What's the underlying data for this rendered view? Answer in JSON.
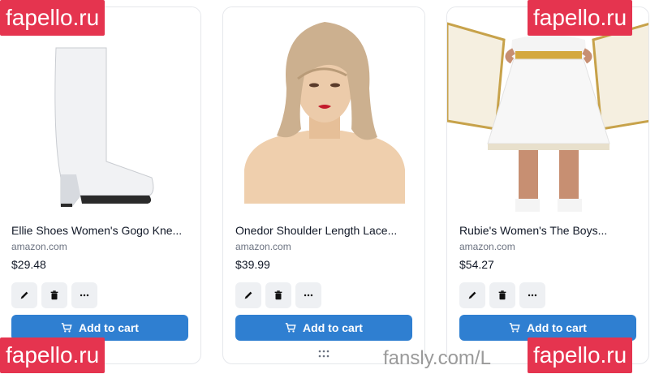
{
  "products": [
    {
      "title": "Ellie Shoes Women's Gogo Kne...",
      "source": "amazon.com",
      "price": "$29.48",
      "image": "white-knee-boot"
    },
    {
      "title": "Onedor Shoulder Length Lace...",
      "source": "amazon.com",
      "price": "$39.99",
      "image": "blonde-wig-on-mannequin"
    },
    {
      "title": "Rubie's Women's The Boys...",
      "source": "amazon.com",
      "price": "$54.27",
      "image": "white-gold-costume"
    }
  ],
  "buttons": {
    "add_to_cart": "Add to cart",
    "edit": "edit-icon",
    "delete": "trash-icon",
    "more": "more-icon"
  },
  "watermarks": {
    "brand": "fapello.ru",
    "footer": "fansly.com/L"
  },
  "colors": {
    "primary": "#2f7fd1",
    "watermark": "#e5344f"
  }
}
